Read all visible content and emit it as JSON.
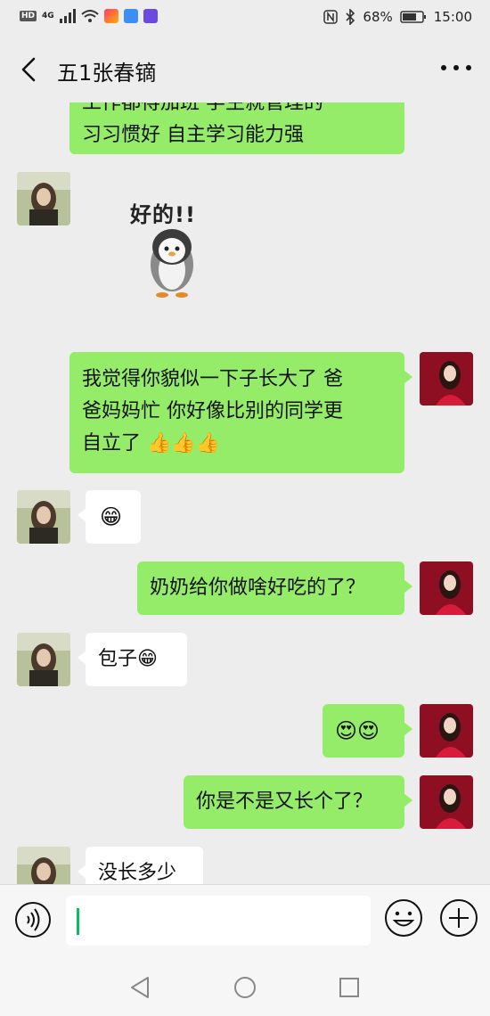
{
  "status_bar": {
    "left_indicators": [
      "HD",
      "4G"
    ],
    "battery": "68%",
    "time": "15:00",
    "icons": [
      "signal-icon",
      "wifi-icon",
      "nfc-icon",
      "bluetooth-icon",
      "battery-icon"
    ]
  },
  "header": {
    "title": "五1张春镝",
    "back_icon": "chevron-left-icon",
    "more_icon": "more-dots-icon"
  },
  "messages": [
    {
      "sender": "me",
      "type": "text",
      "lines": [
        "工作都得加班 学生就管理的",
        "习习惯好 自主学习能力强"
      ]
    },
    {
      "sender": "contact",
      "type": "sticker",
      "sticker_text": "好的!!",
      "sticker_name": "penguin-sticker"
    },
    {
      "sender": "me",
      "type": "text",
      "lines": [
        "我觉得你貌似一下子长大了 爸",
        "爸妈妈忙 你好像比别的同学更",
        "自立了 👍👍👍"
      ]
    },
    {
      "sender": "contact",
      "type": "emoji",
      "lines": [
        "😁"
      ]
    },
    {
      "sender": "me",
      "type": "text",
      "lines": [
        "奶奶给你做啥好吃的了？"
      ]
    },
    {
      "sender": "contact",
      "type": "text",
      "lines": [
        "包子😁"
      ]
    },
    {
      "sender": "me",
      "type": "emoji",
      "lines": [
        "😍😍"
      ]
    },
    {
      "sender": "me",
      "type": "text",
      "lines": [
        "你是不是又长个了？"
      ]
    },
    {
      "sender": "contact",
      "type": "text",
      "lines": [
        "没长多少"
      ]
    }
  ],
  "input_bar": {
    "value": "",
    "voice_icon": "voice-icon",
    "emoji_icon": "emoji-smile-icon",
    "plus_icon": "plus-circle-icon"
  },
  "nav_bar": {
    "icons": [
      "nav-back-icon",
      "nav-home-icon",
      "nav-recent-icon"
    ]
  },
  "colors": {
    "background": "#ededed",
    "my_bubble": "#95ec69",
    "their_bubble": "#ffffff",
    "cursor": "#07c160"
  }
}
